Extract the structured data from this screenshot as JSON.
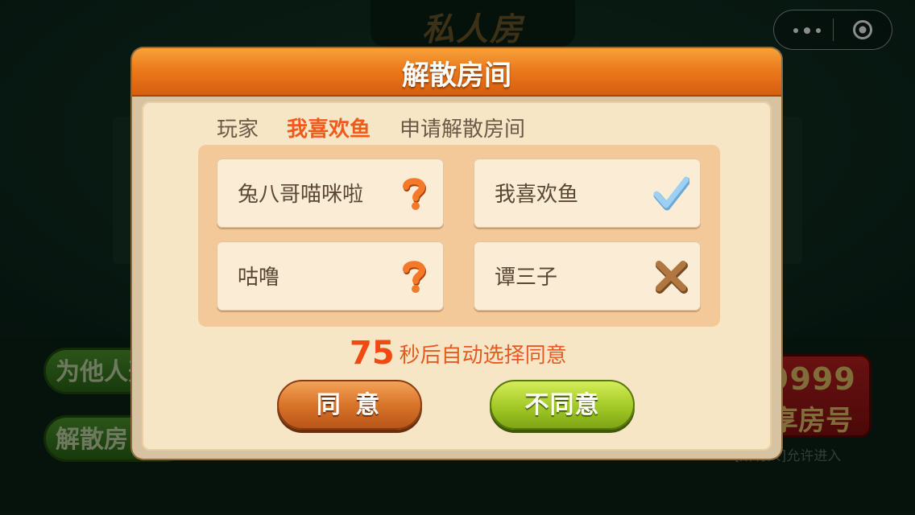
{
  "background": {
    "title_logo": "私人房",
    "buttons": [
      {
        "label": "为他人开"
      },
      {
        "label": "解散房"
      }
    ],
    "room_number": "9999",
    "share_label": "享房号",
    "note": "[所有人]允许进入"
  },
  "dialog": {
    "title": "解散房间",
    "subtitle_prefix": "玩家",
    "requester": "我喜欢鱼",
    "subtitle_suffix": "申请解散房间",
    "players": [
      {
        "name": "兔八哥喵咪啦",
        "status": "pending",
        "icon": "question-icon"
      },
      {
        "name": "我喜欢鱼",
        "status": "agreed",
        "icon": "check-icon"
      },
      {
        "name": "咕噜",
        "status": "pending",
        "icon": "question-icon"
      },
      {
        "name": "谭三子",
        "status": "refused",
        "icon": "cross-icon"
      }
    ],
    "countdown_seconds": "75",
    "countdown_text": "秒后自动选择同意",
    "agree_label": "同 意",
    "disagree_label": "不同意"
  },
  "colors": {
    "header_orange": "#ec7a1c",
    "requester_text": "#f05a1a",
    "agree_button": "#d9742a",
    "disagree_button": "#a6cc2a"
  }
}
